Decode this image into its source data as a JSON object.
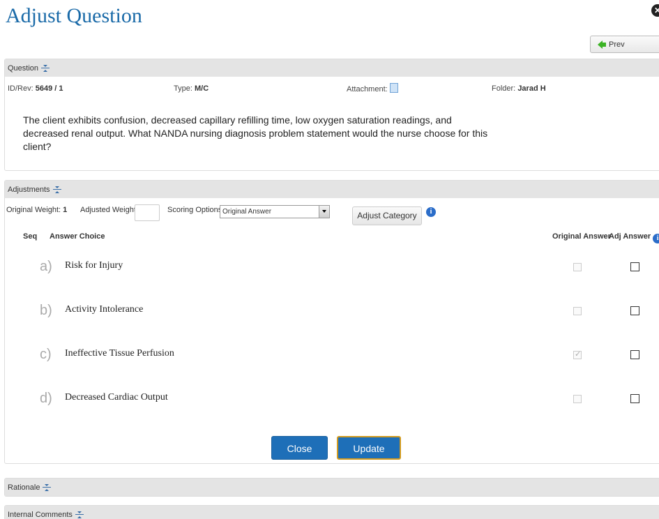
{
  "page": {
    "title": "Adjust Question"
  },
  "nav": {
    "prev_label": "Prev"
  },
  "question": {
    "header": "Question",
    "id_rev_label": "ID/Rev:",
    "id_rev_value": "5649 / 1",
    "type_label": "Type:",
    "type_value": "M/C",
    "attachment_label": "Attachment:",
    "folder_label": "Folder:",
    "folder_value": "Jarad H",
    "text": "The client exhibits confusion, decreased capillary refilling time, low oxygen saturation readings, and decreased renal output. What NANDA nursing diagnosis problem statement would the nurse choose for this client?"
  },
  "adjustments": {
    "header": "Adjustments",
    "original_weight_label": "Original Weight:",
    "original_weight_value": "1",
    "adjusted_weight_label": "Adjusted Weight:",
    "adjusted_weight_value": "",
    "scoring_label": "Scoring Options:",
    "scoring_value": "Original Answer",
    "adjust_category_label": "Adjust Category",
    "columns": {
      "seq": "Seq",
      "answer_choice": "Answer Choice",
      "original_answer": "Original Answer",
      "adj_answer": "Adj Answer"
    },
    "answers": [
      {
        "seq": "a)",
        "text": "Risk for Injury",
        "original_checked": false,
        "adj_checked": false
      },
      {
        "seq": "b)",
        "text": "Activity Intolerance",
        "original_checked": false,
        "adj_checked": false
      },
      {
        "seq": "c)",
        "text": "Ineffective Tissue Perfusion",
        "original_checked": true,
        "adj_checked": false
      },
      {
        "seq": "d)",
        "text": "Decreased Cardiac Output",
        "original_checked": false,
        "adj_checked": false
      }
    ],
    "close_label": "Close",
    "update_label": "Update"
  },
  "rationale": {
    "header": "Rationale"
  },
  "internal_comments": {
    "header": "Internal Comments"
  }
}
